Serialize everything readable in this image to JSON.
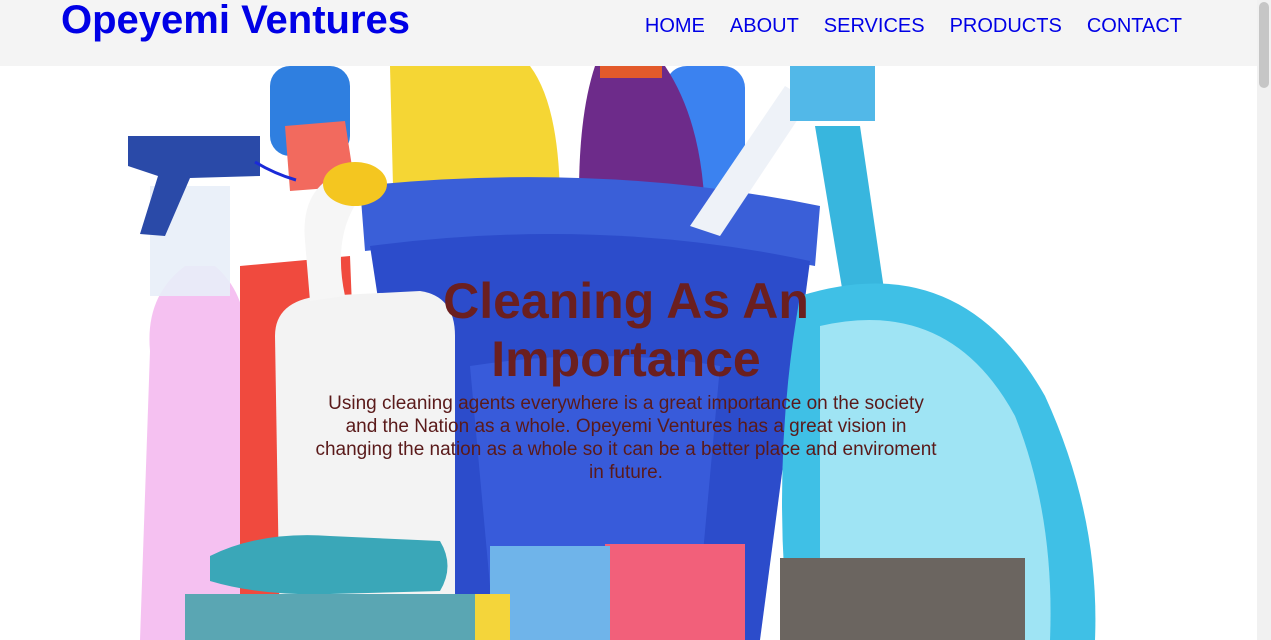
{
  "header": {
    "brand": "Opeyemi Ventures",
    "nav": [
      "HOME",
      "ABOUT",
      "SERVICES",
      "PRODUCTS",
      "CONTACT"
    ]
  },
  "hero": {
    "title": "Cleaning As An Importance",
    "description": "Using cleaning agents everywhere is a great importance on the society and the Nation as a whole. Opeyemi Ventures has a great vision in changing the nation as a whole so it can be a better place and enviroment in future.",
    "image": "cleaning-supplies-bucket"
  },
  "colors": {
    "brand": "#0000e6",
    "header_bg": "#f4f4f4",
    "hero_text": "#6b1f1f"
  }
}
